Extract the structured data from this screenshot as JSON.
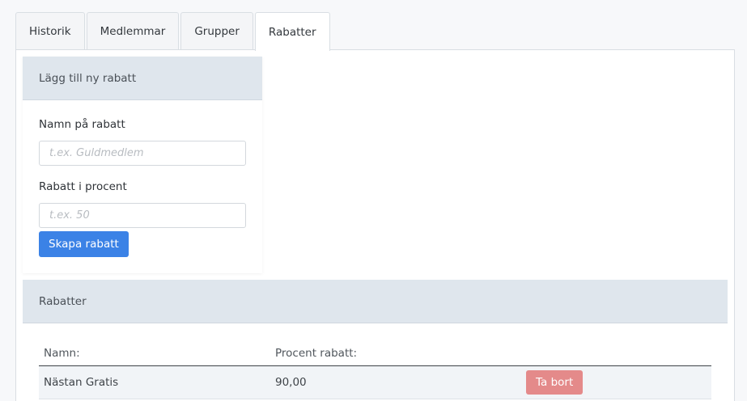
{
  "tabs": [
    {
      "label": "Historik",
      "active": false
    },
    {
      "label": "Medlemmar",
      "active": false
    },
    {
      "label": "Grupper",
      "active": false
    },
    {
      "label": "Rabatter",
      "active": true
    }
  ],
  "add_card": {
    "title": "Lägg till ny rabatt",
    "name_label": "Namn på rabatt",
    "name_placeholder": "t.ex. Guldmedlem",
    "percent_label": "Rabatt i procent",
    "percent_placeholder": "t.ex. 50",
    "submit_label": "Skapa rabatt"
  },
  "list_card": {
    "title": "Rabatter",
    "columns": [
      "Namn:",
      "Procent rabatt:",
      ""
    ],
    "rows": [
      {
        "name": "Nästan Gratis",
        "percent": "90,00",
        "action_label": "Ta bort"
      }
    ]
  },
  "colors": {
    "primary": "#3b82e6",
    "danger": "#e48a8a",
    "header_bg": "#dfe6ed"
  }
}
